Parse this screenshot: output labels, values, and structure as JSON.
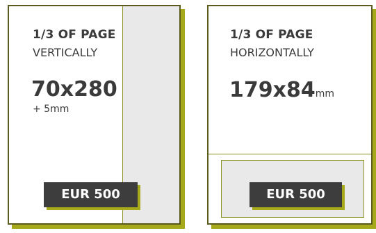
{
  "cards": [
    {
      "title": "1/3 OF PAGE",
      "orientation": "VERTICALLY",
      "dimensions": "70x280",
      "extra": "+ 5mm",
      "price": "EUR 500"
    },
    {
      "title": "1/3 OF PAGE",
      "orientation": "HORIZONTALLY",
      "dimensions": "179x84",
      "unit": "mm",
      "price": "EUR 500"
    }
  ],
  "colors": {
    "accent": "#a5a91a",
    "border": "#5a5a1e",
    "shade": "#e9e9e9",
    "price_bg": "#3d3d3d"
  }
}
